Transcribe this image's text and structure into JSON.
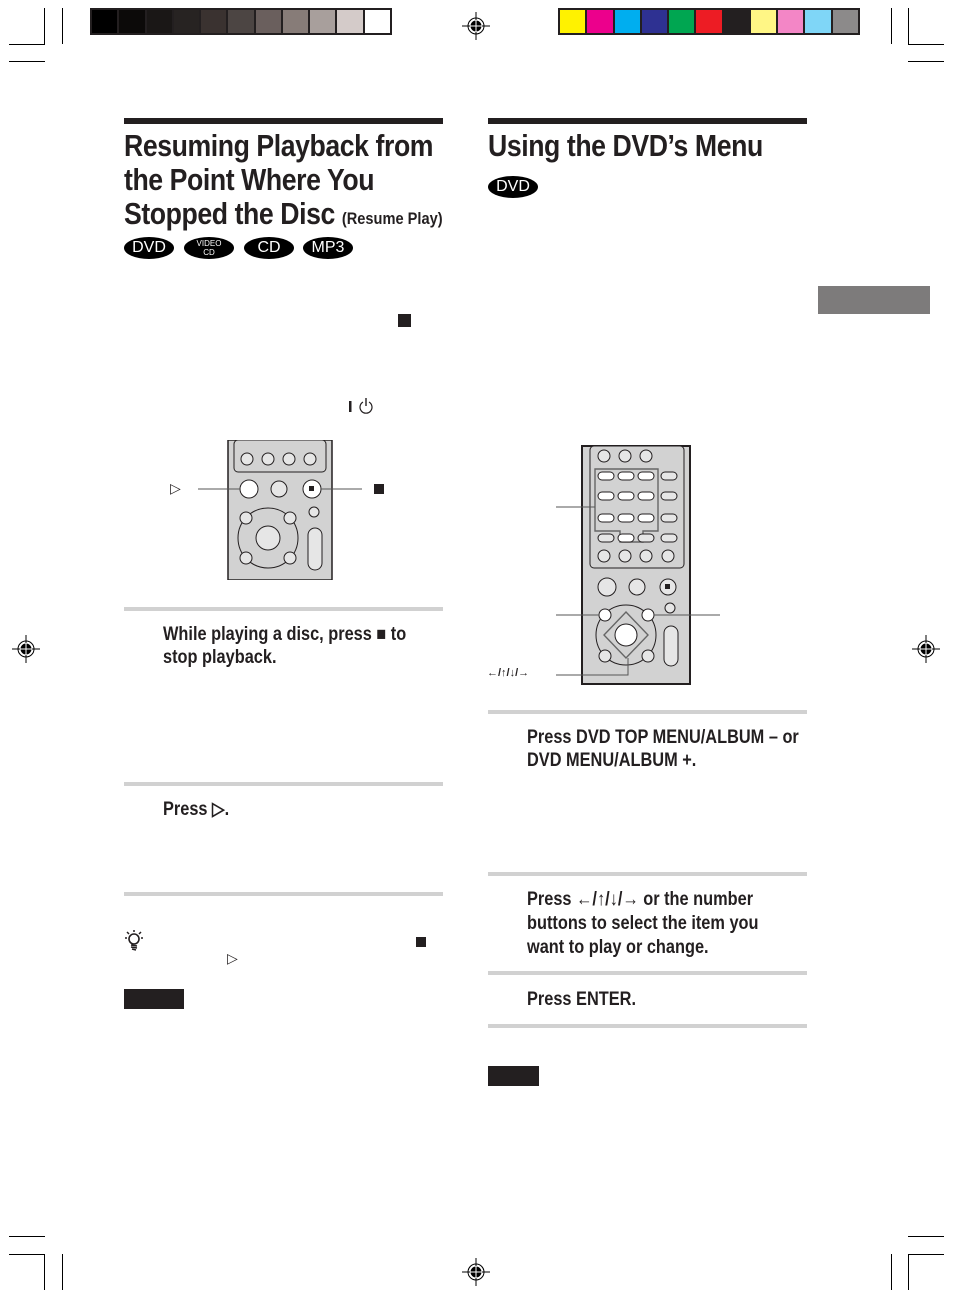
{
  "printer_marks": {
    "grayscale_swatches": [
      "#000000",
      "#0c0a09",
      "#1a1716",
      "#272322",
      "#3a3230",
      "#4c4543",
      "#6a5f5d",
      "#877c78",
      "#a89f9c",
      "#d4cbc9",
      "#ffffff"
    ],
    "color_swatches": [
      "#fff200",
      "#ec008c",
      "#00aeef",
      "#2e3192",
      "#00a651",
      "#ed1c24",
      "#231f20",
      "#fff685",
      "#f386c6",
      "#7fd6f7",
      "#8c8a8a"
    ]
  },
  "left_section": {
    "title_line1": "Resuming Playback from",
    "title_line2": "the Point Where You",
    "title_line3": "Stopped the Disc",
    "title_suffix": "(Resume Play)",
    "disc_badges": [
      "DVD",
      "VIDEO CD",
      "CD",
      "MP3"
    ],
    "badge_vcd_top": "VIDEO",
    "badge_vcd_bottom": "CD",
    "inline_symbols": {
      "stop": "■",
      "power": "I ⏻"
    },
    "remote_labels": {
      "play": "▷",
      "stop": "■"
    },
    "steps": [
      {
        "text_line1": "While playing a disc, press ■ to",
        "text_line2": "stop playback."
      },
      {
        "text_line1": "Press ▷."
      }
    ],
    "tip_symbols": {
      "stop": "■",
      "play": "▷"
    }
  },
  "right_section": {
    "title": "Using the DVD’s Menu",
    "disc_badges": [
      "DVD"
    ],
    "remote_labels": {
      "arrows": "←/↑/↓/→"
    },
    "steps": [
      {
        "text_line1": "Press DVD TOP MENU/ALBUM – or",
        "text_line2": "DVD MENU/ALBUM +."
      },
      {
        "text_line1": "Press ←/↑/↓/→ or the number",
        "text_line2": "buttons to select the item you",
        "text_line3": "want to play or change."
      },
      {
        "text_line1": "Press ENTER."
      }
    ]
  }
}
